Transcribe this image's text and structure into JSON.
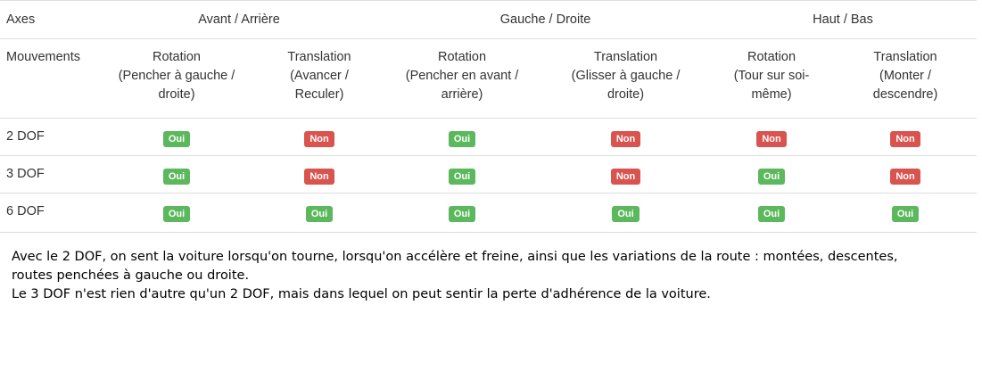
{
  "table": {
    "header": {
      "axes_label": "Axes",
      "groups": [
        "Avant / Arrière",
        "Gauche / Droite",
        "Haut / Bas"
      ]
    },
    "movements": {
      "label": "Mouvements",
      "columns": [
        [
          "Rotation",
          "(Pencher à gauche /",
          "droite)"
        ],
        [
          "Translation",
          "(Avancer /",
          "Reculer)"
        ],
        [
          "Rotation",
          "(Pencher en avant /",
          "arrière)"
        ],
        [
          "Translation",
          "(Glisser à gauche /",
          "droite)"
        ],
        [
          "Rotation",
          "(Tour sur soi-",
          "même)"
        ],
        [
          "Translation",
          "(Monter /",
          "descendre)"
        ]
      ]
    },
    "rows": [
      {
        "label": "2 DOF",
        "values": [
          "Oui",
          "Non",
          "Oui",
          "Non",
          "Non",
          "Non"
        ]
      },
      {
        "label": "3 DOF",
        "values": [
          "Oui",
          "Non",
          "Oui",
          "Non",
          "Oui",
          "Non"
        ]
      },
      {
        "label": "6 DOF",
        "values": [
          "Oui",
          "Oui",
          "Oui",
          "Oui",
          "Oui",
          "Oui"
        ]
      }
    ]
  },
  "description": {
    "line1": "Avec le 2 DOF, on sent la voiture lorsqu'on tourne, lorsqu'on accélère et freine, ainsi que les variations de la route : montées, descentes,",
    "line2": "routes penchées à gauche ou droite.",
    "line3": "Le 3 DOF n'est rien d'autre qu'un 2 DOF, mais dans lequel on peut sentir la perte d'adhérence de la voiture."
  },
  "colors": {
    "yes_badge": "#5cb85c",
    "no_badge": "#d9534f",
    "border": "#dddddd",
    "table_text": "#333333"
  }
}
